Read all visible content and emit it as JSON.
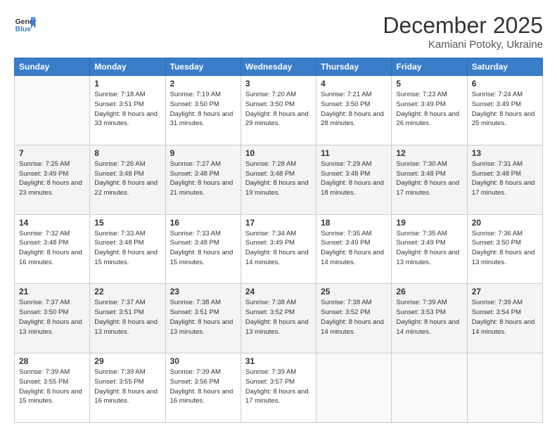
{
  "logo": {
    "general": "General",
    "blue": "Blue"
  },
  "header": {
    "month": "December 2025",
    "location": "Kamiani Potoky, Ukraine"
  },
  "weekdays": [
    "Sunday",
    "Monday",
    "Tuesday",
    "Wednesday",
    "Thursday",
    "Friday",
    "Saturday"
  ],
  "weeks": [
    [
      {
        "day": "",
        "sunrise": "",
        "sunset": "",
        "daylight": ""
      },
      {
        "day": "1",
        "sunrise": "Sunrise: 7:18 AM",
        "sunset": "Sunset: 3:51 PM",
        "daylight": "Daylight: 8 hours and 33 minutes."
      },
      {
        "day": "2",
        "sunrise": "Sunrise: 7:19 AM",
        "sunset": "Sunset: 3:50 PM",
        "daylight": "Daylight: 8 hours and 31 minutes."
      },
      {
        "day": "3",
        "sunrise": "Sunrise: 7:20 AM",
        "sunset": "Sunset: 3:50 PM",
        "daylight": "Daylight: 8 hours and 29 minutes."
      },
      {
        "day": "4",
        "sunrise": "Sunrise: 7:21 AM",
        "sunset": "Sunset: 3:50 PM",
        "daylight": "Daylight: 8 hours and 28 minutes."
      },
      {
        "day": "5",
        "sunrise": "Sunrise: 7:23 AM",
        "sunset": "Sunset: 3:49 PM",
        "daylight": "Daylight: 8 hours and 26 minutes."
      },
      {
        "day": "6",
        "sunrise": "Sunrise: 7:24 AM",
        "sunset": "Sunset: 3:49 PM",
        "daylight": "Daylight: 8 hours and 25 minutes."
      }
    ],
    [
      {
        "day": "7",
        "sunrise": "Sunrise: 7:25 AM",
        "sunset": "Sunset: 3:49 PM",
        "daylight": "Daylight: 8 hours and 23 minutes."
      },
      {
        "day": "8",
        "sunrise": "Sunrise: 7:26 AM",
        "sunset": "Sunset: 3:48 PM",
        "daylight": "Daylight: 8 hours and 22 minutes."
      },
      {
        "day": "9",
        "sunrise": "Sunrise: 7:27 AM",
        "sunset": "Sunset: 3:48 PM",
        "daylight": "Daylight: 8 hours and 21 minutes."
      },
      {
        "day": "10",
        "sunrise": "Sunrise: 7:28 AM",
        "sunset": "Sunset: 3:48 PM",
        "daylight": "Daylight: 8 hours and 19 minutes."
      },
      {
        "day": "11",
        "sunrise": "Sunrise: 7:29 AM",
        "sunset": "Sunset: 3:48 PM",
        "daylight": "Daylight: 8 hours and 18 minutes."
      },
      {
        "day": "12",
        "sunrise": "Sunrise: 7:30 AM",
        "sunset": "Sunset: 3:48 PM",
        "daylight": "Daylight: 8 hours and 17 minutes."
      },
      {
        "day": "13",
        "sunrise": "Sunrise: 7:31 AM",
        "sunset": "Sunset: 3:48 PM",
        "daylight": "Daylight: 8 hours and 17 minutes."
      }
    ],
    [
      {
        "day": "14",
        "sunrise": "Sunrise: 7:32 AM",
        "sunset": "Sunset: 3:48 PM",
        "daylight": "Daylight: 8 hours and 16 minutes."
      },
      {
        "day": "15",
        "sunrise": "Sunrise: 7:33 AM",
        "sunset": "Sunset: 3:48 PM",
        "daylight": "Daylight: 8 hours and 15 minutes."
      },
      {
        "day": "16",
        "sunrise": "Sunrise: 7:33 AM",
        "sunset": "Sunset: 3:48 PM",
        "daylight": "Daylight: 8 hours and 15 minutes."
      },
      {
        "day": "17",
        "sunrise": "Sunrise: 7:34 AM",
        "sunset": "Sunset: 3:49 PM",
        "daylight": "Daylight: 8 hours and 14 minutes."
      },
      {
        "day": "18",
        "sunrise": "Sunrise: 7:35 AM",
        "sunset": "Sunset: 3:49 PM",
        "daylight": "Daylight: 8 hours and 14 minutes."
      },
      {
        "day": "19",
        "sunrise": "Sunrise: 7:35 AM",
        "sunset": "Sunset: 3:49 PM",
        "daylight": "Daylight: 8 hours and 13 minutes."
      },
      {
        "day": "20",
        "sunrise": "Sunrise: 7:36 AM",
        "sunset": "Sunset: 3:50 PM",
        "daylight": "Daylight: 8 hours and 13 minutes."
      }
    ],
    [
      {
        "day": "21",
        "sunrise": "Sunrise: 7:37 AM",
        "sunset": "Sunset: 3:50 PM",
        "daylight": "Daylight: 8 hours and 13 minutes."
      },
      {
        "day": "22",
        "sunrise": "Sunrise: 7:37 AM",
        "sunset": "Sunset: 3:51 PM",
        "daylight": "Daylight: 8 hours and 13 minutes."
      },
      {
        "day": "23",
        "sunrise": "Sunrise: 7:38 AM",
        "sunset": "Sunset: 3:51 PM",
        "daylight": "Daylight: 8 hours and 13 minutes."
      },
      {
        "day": "24",
        "sunrise": "Sunrise: 7:38 AM",
        "sunset": "Sunset: 3:52 PM",
        "daylight": "Daylight: 8 hours and 13 minutes."
      },
      {
        "day": "25",
        "sunrise": "Sunrise: 7:38 AM",
        "sunset": "Sunset: 3:52 PM",
        "daylight": "Daylight: 8 hours and 14 minutes."
      },
      {
        "day": "26",
        "sunrise": "Sunrise: 7:39 AM",
        "sunset": "Sunset: 3:53 PM",
        "daylight": "Daylight: 8 hours and 14 minutes."
      },
      {
        "day": "27",
        "sunrise": "Sunrise: 7:39 AM",
        "sunset": "Sunset: 3:54 PM",
        "daylight": "Daylight: 8 hours and 14 minutes."
      }
    ],
    [
      {
        "day": "28",
        "sunrise": "Sunrise: 7:39 AM",
        "sunset": "Sunset: 3:55 PM",
        "daylight": "Daylight: 8 hours and 15 minutes."
      },
      {
        "day": "29",
        "sunrise": "Sunrise: 7:39 AM",
        "sunset": "Sunset: 3:55 PM",
        "daylight": "Daylight: 8 hours and 16 minutes."
      },
      {
        "day": "30",
        "sunrise": "Sunrise: 7:39 AM",
        "sunset": "Sunset: 3:56 PM",
        "daylight": "Daylight: 8 hours and 16 minutes."
      },
      {
        "day": "31",
        "sunrise": "Sunrise: 7:39 AM",
        "sunset": "Sunset: 3:57 PM",
        "daylight": "Daylight: 8 hours and 17 minutes."
      },
      {
        "day": "",
        "sunrise": "",
        "sunset": "",
        "daylight": ""
      },
      {
        "day": "",
        "sunrise": "",
        "sunset": "",
        "daylight": ""
      },
      {
        "day": "",
        "sunrise": "",
        "sunset": "",
        "daylight": ""
      }
    ]
  ]
}
